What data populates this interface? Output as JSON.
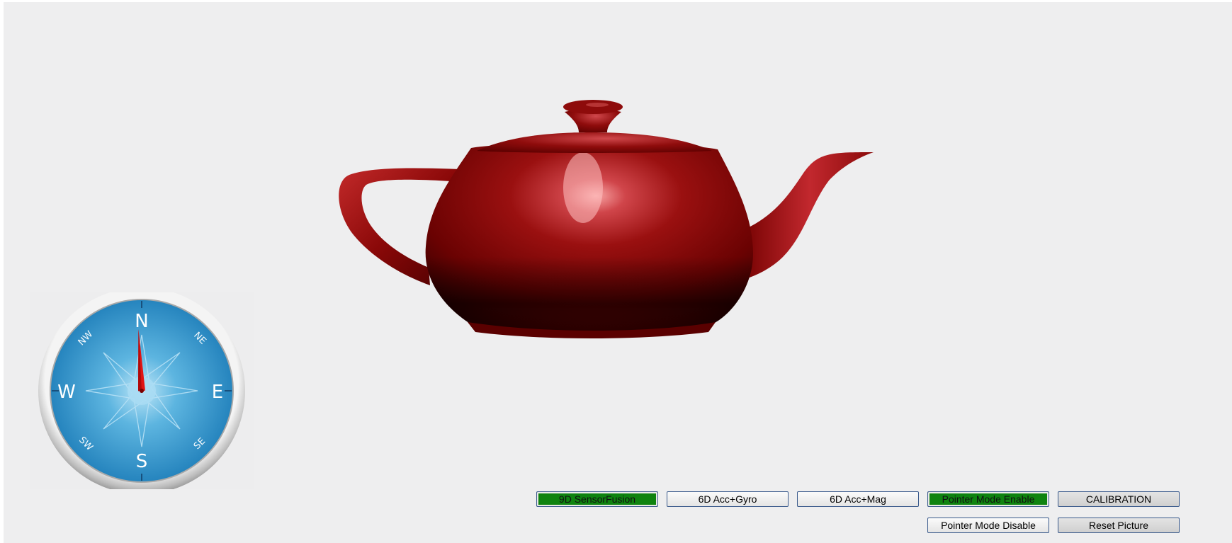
{
  "compass": {
    "north": "N",
    "south": "S",
    "east": "E",
    "west": "W",
    "northeast": "NE",
    "northwest": "NW",
    "southeast": "SE",
    "southwest": "SW",
    "heading_deg": -3,
    "dial_color": "#2e8fc9",
    "needle_color": "#e01414"
  },
  "teapot": {
    "color": "#8a0a0a"
  },
  "buttons": {
    "sensor_fusion_9d": "9D SensorFusion",
    "acc_gyro_6d": "6D Acc+Gyro",
    "acc_mag_6d": "6D Acc+Mag",
    "pointer_enable": "Pointer Mode Enable",
    "calibration": "CALIBRATION",
    "pointer_disable": "Pointer Mode Disable",
    "reset_picture": "Reset Picture"
  },
  "colors": {
    "active_button": "#0f830f",
    "background": "#eeeeef"
  }
}
